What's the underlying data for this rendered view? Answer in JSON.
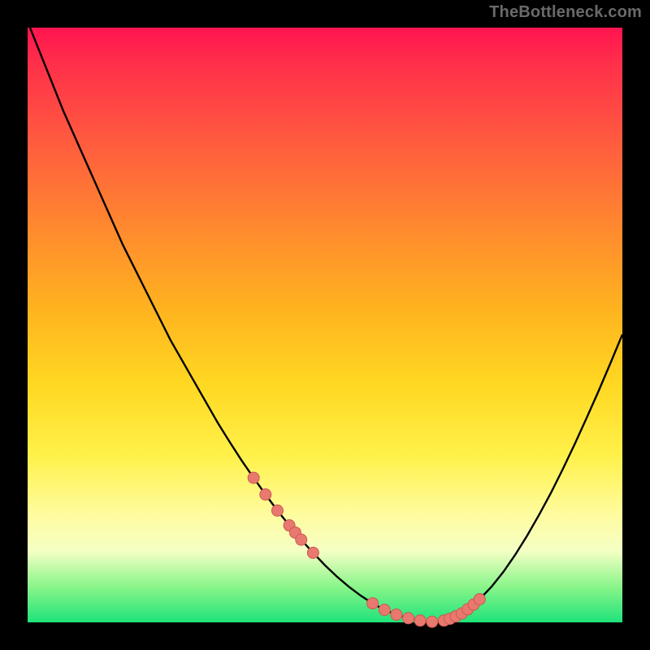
{
  "watermark": "TheBottleneck.com",
  "colors": {
    "background": "#000000",
    "gradient_top": "#ff1450",
    "gradient_mid1": "#ff8a2e",
    "gradient_mid2": "#ffd822",
    "gradient_mid3": "#fffca0",
    "gradient_bottom": "#1ee37a",
    "curve": "#000000",
    "marker_fill": "#e9786f",
    "marker_stroke": "#c95a53"
  },
  "chart_data": {
    "type": "line",
    "title": "",
    "xlabel": "",
    "ylabel": "",
    "xlim": [
      0,
      100
    ],
    "ylim": [
      0,
      100
    ],
    "series": [
      {
        "name": "bottleneck-curve",
        "x": [
          0,
          2,
          4,
          6,
          8,
          10,
          12,
          14,
          16,
          18,
          20,
          22,
          24,
          26,
          28,
          30,
          32,
          34,
          36,
          38,
          40,
          42,
          44,
          46,
          48,
          50,
          52,
          54,
          56,
          58,
          60,
          62,
          64,
          66,
          68,
          70,
          72,
          74,
          76,
          78,
          80,
          82,
          84,
          86,
          88,
          90,
          92,
          94,
          96,
          98,
          100
        ],
        "y": [
          101,
          96,
          91,
          86,
          81.5,
          77,
          72.5,
          68,
          63.5,
          59.5,
          55.5,
          51.5,
          47.5,
          44,
          40.5,
          37,
          33.5,
          30.3,
          27.2,
          24.3,
          21.5,
          18.8,
          16.3,
          13.9,
          11.7,
          9.6,
          7.7,
          6.0,
          4.5,
          3.2,
          2.1,
          1.3,
          0.7,
          0.3,
          0.1,
          0.3,
          1.0,
          2.2,
          3.9,
          6.0,
          8.5,
          11.4,
          14.6,
          18.1,
          21.8,
          25.8,
          30.0,
          34.4,
          38.9,
          43.6,
          48.4
        ]
      }
    ],
    "markers": {
      "name": "highlight-points",
      "x": [
        38,
        40,
        42,
        44,
        45,
        46,
        48,
        58,
        60,
        62,
        64,
        66,
        68,
        70,
        71,
        72,
        73,
        74,
        75,
        76
      ],
      "y": [
        24.3,
        21.5,
        18.8,
        16.3,
        15.1,
        13.9,
        11.7,
        3.2,
        2.1,
        1.3,
        0.7,
        0.3,
        0.1,
        0.3,
        0.6,
        1.0,
        1.5,
        2.2,
        3.0,
        3.9
      ]
    }
  }
}
